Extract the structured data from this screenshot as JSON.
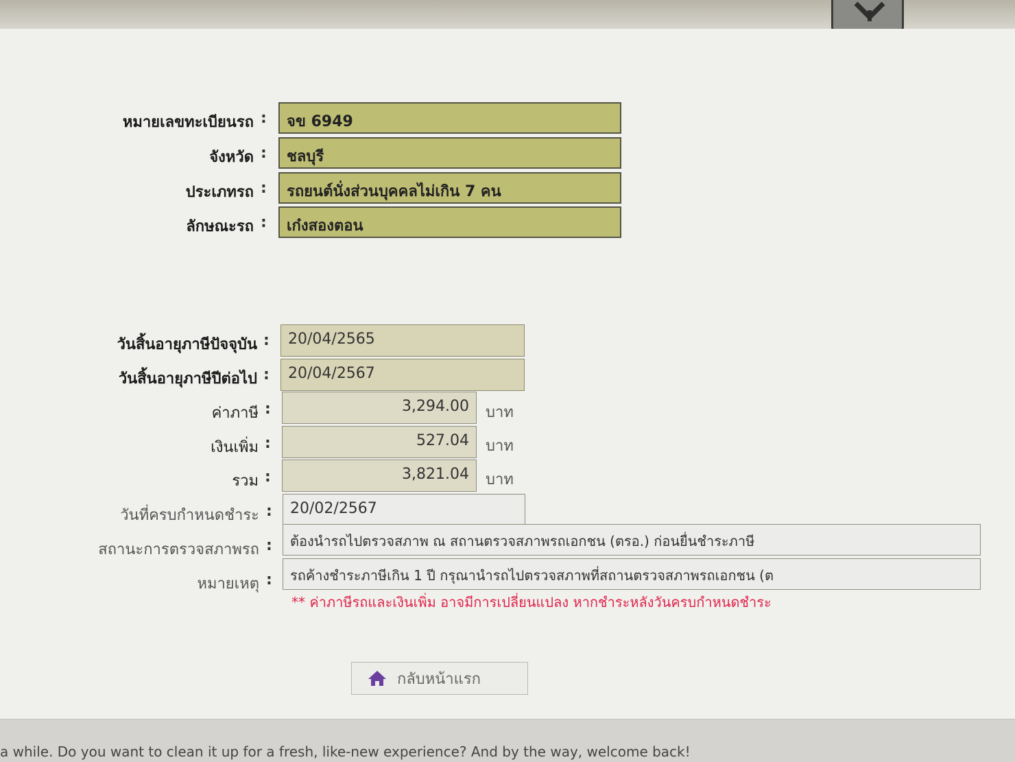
{
  "vehicle": {
    "fields": [
      {
        "label": "หมายเลขทะเบียนรถ",
        "value": "จข 6949"
      },
      {
        "label": "จังหวัด",
        "value": "ชลบุรี"
      },
      {
        "label": "ประเภทรถ",
        "value": "รถยนต์นั่งส่วนบุคคลไม่เกิน 7 คน"
      },
      {
        "label": "ลักษณะรถ",
        "value": "เก๋งสองตอน"
      }
    ]
  },
  "tax": {
    "current_expiry": {
      "label": "วันสิ้นอายุภาษีปัจจุบัน",
      "value": "20/04/2565"
    },
    "next_expiry": {
      "label": "วันสิ้นอายุภาษีปีต่อไป",
      "value": "20/04/2567"
    },
    "tax_amount": {
      "label": "ค่าภาษี",
      "value": "3,294.00",
      "unit": "บาท"
    },
    "surcharge": {
      "label": "เงินเพิ่ม",
      "value": "527.04",
      "unit": "บาท"
    },
    "total": {
      "label": "รวม",
      "value": "3,821.04",
      "unit": "บาท"
    },
    "due_date": {
      "label": "วันที่ครบกำหนดชำระ",
      "value": "20/02/2567"
    },
    "inspection_status": {
      "label": "สถานะการตรวจสภาพรถ",
      "value": "ต้องนำรถไปตรวจสภาพ ณ สถานตรวจสภาพรถเอกชน (ตรอ.) ก่อนยื่นชำระภาษี"
    },
    "remark": {
      "label": "หมายเหตุ",
      "value": "รถค้างชำระภาษีเกิน 1 ปี กรุณานำรถไปตรวจสภาพที่สถานตรวจสภาพรถเอกชน (ต"
    }
  },
  "colon": ":",
  "warning": "** ค่าภาษีรถและเงินเพิ่ม อาจมีการเปลี่ยนแปลง หากชำระหลังวันครบกำหนดชำระ",
  "home_button": {
    "label": "กลับหน้าแรก",
    "icon": "home-icon"
  },
  "notification": "a while. Do you want to clean it up for a fresh, like-new experience? And by the way, welcome back!",
  "colors": {
    "olive_field": "#bdbd74",
    "warning_red": "#e0244a",
    "home_icon": "#6a3fa0"
  }
}
